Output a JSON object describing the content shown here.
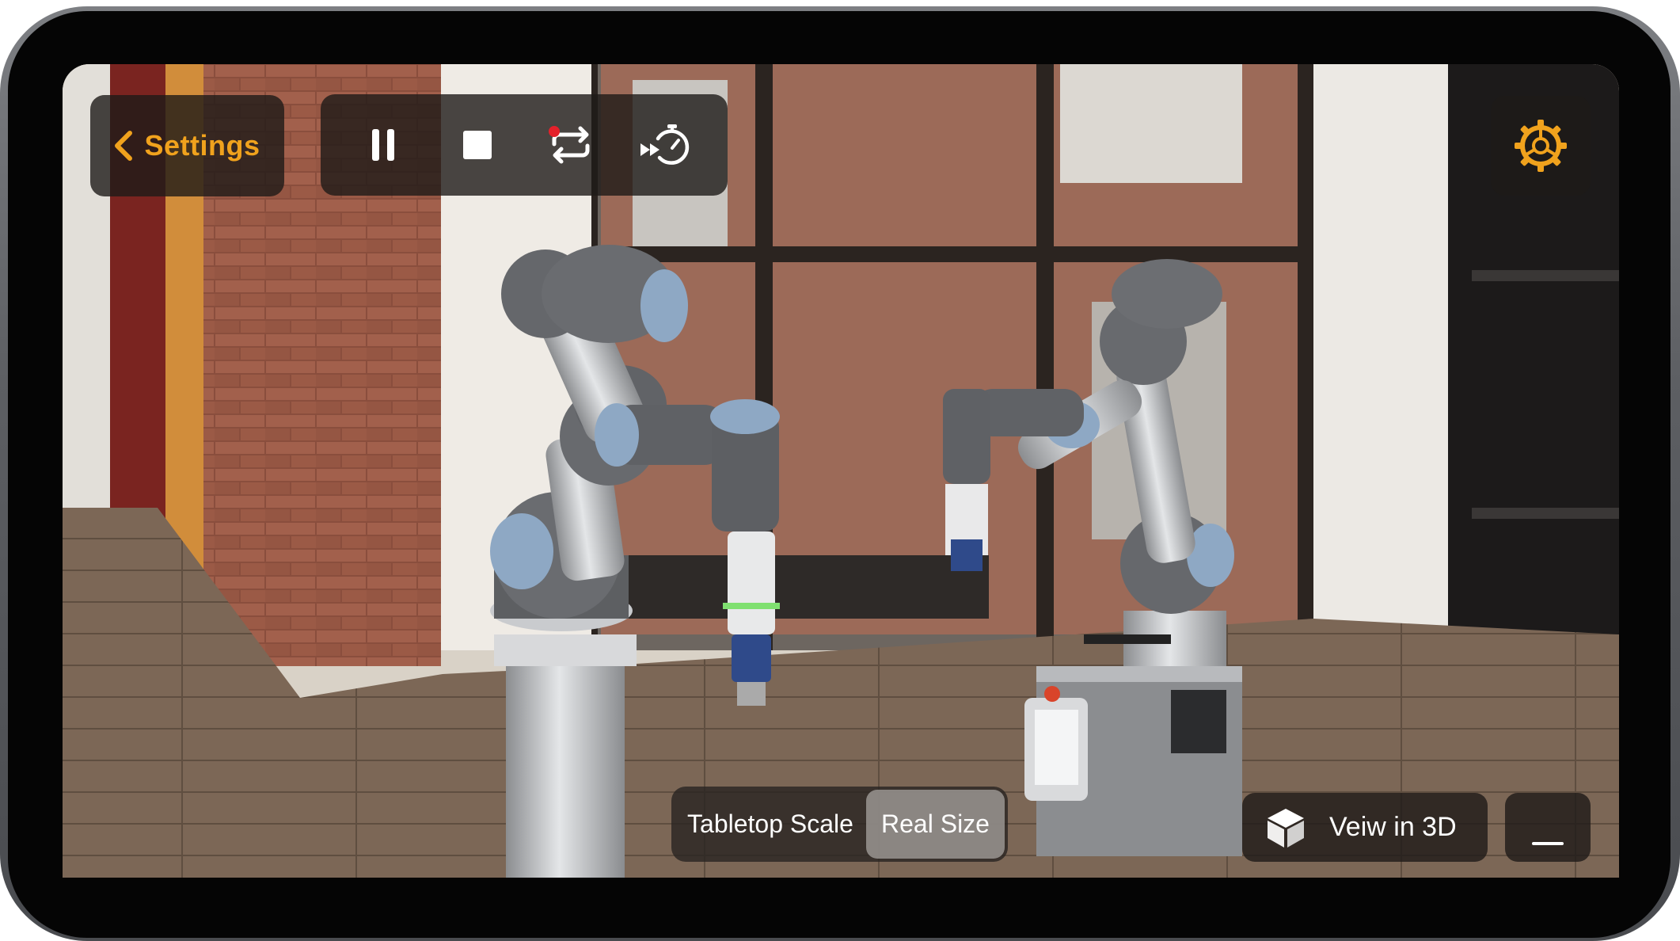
{
  "toolbar": {
    "back_label": "Settings",
    "back_icon": "chevron-left-icon",
    "pause_icon": "pause-icon",
    "stop_icon": "stop-icon",
    "repeat_icon": "repeat-icon",
    "fast_forward_timer_icon": "fast-forward-timer-icon",
    "settings_icon": "gear-icon"
  },
  "scale_toggle": {
    "options": [
      "Tabletop Scale",
      "Real Size"
    ],
    "selected": "Real Size"
  },
  "view_3d": {
    "label": "Veiw in 3D",
    "icon": "cube-icon"
  },
  "minimize": {
    "icon": "minimize-icon"
  },
  "colors": {
    "accent": "#f0a21d",
    "panel": "#1e1a18",
    "recording_dot": "#e5202a"
  }
}
